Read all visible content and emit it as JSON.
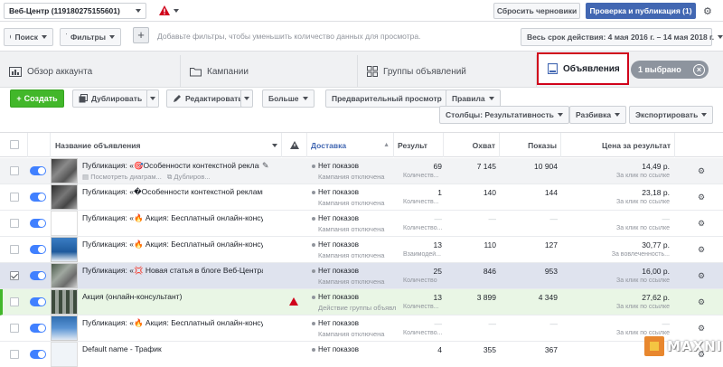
{
  "topbar": {
    "account_label": "Веб-Центр (119180275155601)",
    "reset_label": "Сбросить черновики",
    "publish_label": "Проверка и публикация (1)"
  },
  "filterbar": {
    "search_label": "Поиск",
    "filters_label": "Фильтры",
    "hint": "Добавьте фильтры, чтобы уменьшить количество данных для просмотра.",
    "date_range": "Весь срок действия: 4 мая 2016 г. – 14 мая 2018 г."
  },
  "tabs": {
    "overview": "Обзор аккаунта",
    "campaigns": "Кампании",
    "adsets": "Группы объявлений",
    "ads": "Объявления",
    "selected": "1 выбрано"
  },
  "actions": {
    "create": "Создать",
    "duplicate": "Дублировать",
    "edit": "Редактировать",
    "more": "Больше",
    "preview": "Предварительный просмотр",
    "rules": "Правила",
    "columns": "Столбцы: Результативность",
    "breakdown": "Разбивка",
    "export": "Экспортировать"
  },
  "columns": {
    "name": "Название объявления",
    "delivery": "Доставка",
    "results": "Результ",
    "reach": "Охват",
    "impressions": "Показы",
    "cost": "Цена за результат"
  },
  "rows": [
    {
      "name": "Публикация: «🎯Особенности контекстной реклам...",
      "sub1": "Посмотреть диаграм...",
      "sub2": "Дублиров...",
      "delivery": "Нет показов",
      "delivery_sub": "Кампания отключена",
      "results": "69",
      "results_sub": "Количеств...",
      "reach": "7 145",
      "impressions": "10 904",
      "cost": "14,49 р.",
      "cost_sub": "За клик по ссылке"
    },
    {
      "name": "Публикация: «�Особенности контекстной рекламы д...",
      "delivery": "Нет показов",
      "delivery_sub": "Кампания отключена",
      "results": "1",
      "results_sub": "Количеств...",
      "reach": "140",
      "impressions": "144",
      "cost": "23,18 р.",
      "cost_sub": "За клик по ссылке"
    },
    {
      "name": "Публикация: «🔥 Акция: Бесплатный онлайн-консульт...",
      "delivery": "Нет показов",
      "delivery_sub": "Кампания отключена",
      "results": "—",
      "results_sub": "Количество...",
      "reach": "—",
      "impressions": "—",
      "cost": "—",
      "cost_sub": "За клик по ссылке"
    },
    {
      "name": "Публикация: «🔥 Акция: Бесплатный онлайн-консульт...",
      "delivery": "Нет показов",
      "delivery_sub": "Кампания отключена",
      "results": "13",
      "results_sub": "Взаимодей...",
      "reach": "110",
      "impressions": "127",
      "cost": "30,77 р.",
      "cost_sub": "За вовлеченность..."
    },
    {
      "name": "Публикация: «💢 Новая статья в блоге Веб-Центра: ...",
      "delivery": "Нет показов",
      "delivery_sub": "Кампания отключена",
      "results": "25",
      "results_sub": "Количество",
      "reach": "846",
      "impressions": "953",
      "cost": "16,00 р.",
      "cost_sub": "За клик по ссылке"
    },
    {
      "name": "Акция (онлайн-консультант)",
      "delivery": "Нет показов",
      "delivery_sub": "Действие группы объявл...",
      "results": "13",
      "results_sub": "Количеств...",
      "reach": "3 899",
      "impressions": "4 349",
      "cost": "27,62 р.",
      "cost_sub": "За клик по ссылке"
    },
    {
      "name": "Публикация: «🔥 Акция: Бесплатный онлайн-консульт...",
      "delivery": "Нет показов",
      "delivery_sub": "Кампания отключена",
      "results": "—",
      "results_sub": "Количество...",
      "reach": "—",
      "impressions": "—",
      "cost": "—",
      "cost_sub": "За клик по ссылке"
    },
    {
      "name": "Default name - Трафик",
      "delivery": "Нет показов",
      "delivery_sub": "Кампания отключена",
      "results": "4",
      "results_sub": "",
      "reach": "355",
      "impressions": "367",
      "cost": "",
      "cost_sub": ""
    }
  ],
  "watermark": "MAXNI"
}
